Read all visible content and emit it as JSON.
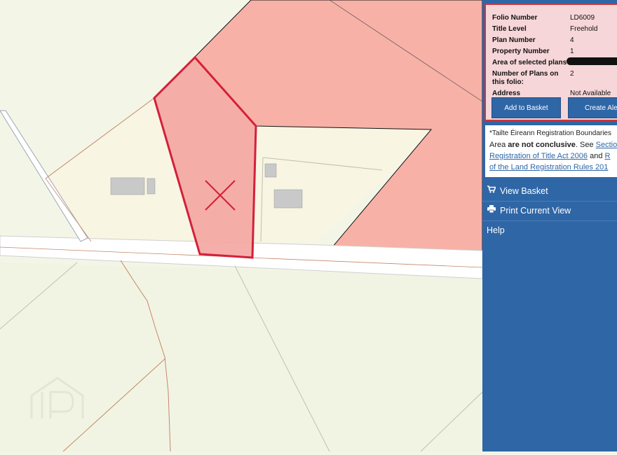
{
  "folio": {
    "rows": [
      {
        "key": "Folio Number",
        "value": "LD6009"
      },
      {
        "key": "Title Level",
        "value": "Freehold"
      },
      {
        "key": "Plan Number",
        "value": "4"
      },
      {
        "key": "Property Number",
        "value": "1"
      },
      {
        "key": "Area of selected plans",
        "value": ""
      },
      {
        "key": "Number of Plans on",
        "key2": "this folio:",
        "value": "2"
      },
      {
        "key": "Address",
        "value": "Not Available"
      }
    ],
    "add_to_basket": "Add to Basket",
    "create_alert": "Create Alert"
  },
  "notice": {
    "line1": "*Tailte Éireann Registration Boundaries",
    "line2_a": "Area ",
    "line2_b": "are not conclusive",
    "line2_c": ". See ",
    "line2_link": "Section",
    "line3_link": "Registration of Title Act 2006",
    "line3_and": " and ",
    "line3_link2": "R",
    "line4_link": "of the Land Registration Rules 201"
  },
  "menu": {
    "view_basket": "View Basket",
    "print_view": "Print Current View",
    "help": "Help"
  },
  "colors": {
    "selected_plot": "#f4a7a2",
    "selected_border": "#d3203a",
    "other_plot": "#f8b1a7",
    "background": "#f3f6e6",
    "sidebar": "#2f66a6"
  }
}
